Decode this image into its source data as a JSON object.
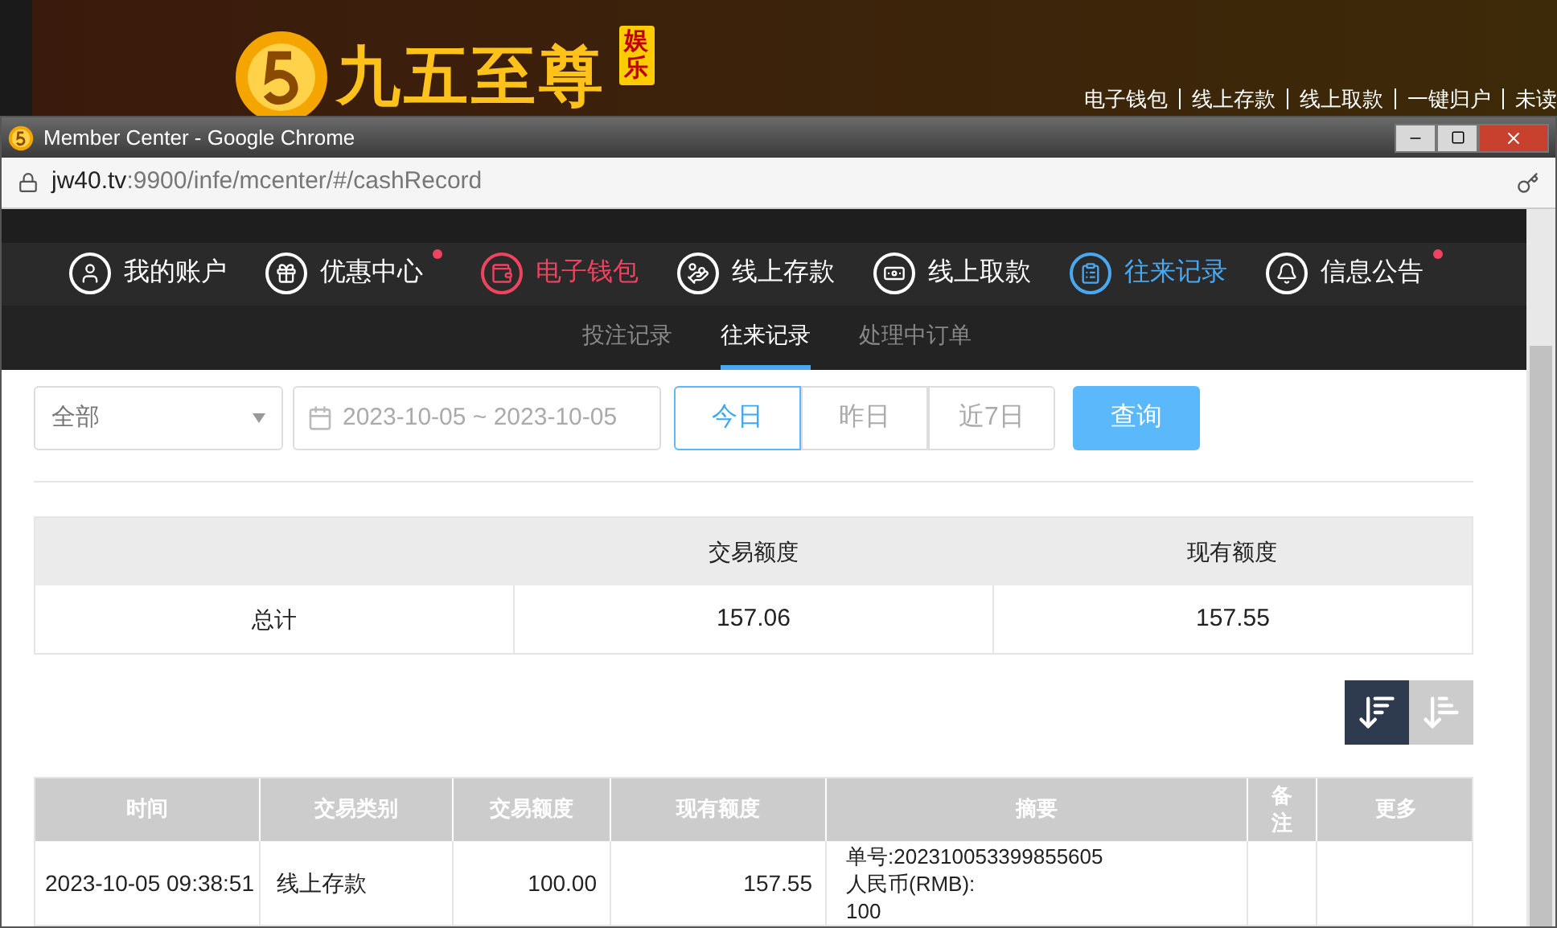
{
  "background_site": {
    "logo_text": "九五至尊",
    "logo_badge": "娱乐",
    "links": [
      "电子钱包",
      "线上存款",
      "线上取款",
      "一键归户",
      "未读"
    ]
  },
  "window": {
    "title": "Member Center - Google Chrome",
    "url_host": "jw40.tv",
    "url_path": ":9900/infe/mcenter/#/cashRecord"
  },
  "nav": [
    {
      "label": "我的账户",
      "dot": false,
      "selected": false,
      "highlighted": false
    },
    {
      "label": "优惠中心",
      "dot": true,
      "selected": false,
      "highlighted": false
    },
    {
      "label": "电子钱包",
      "dot": false,
      "selected": false,
      "highlighted": true
    },
    {
      "label": "线上存款",
      "dot": false,
      "selected": false,
      "highlighted": false
    },
    {
      "label": "线上取款",
      "dot": false,
      "selected": false,
      "highlighted": false
    },
    {
      "label": "往来记录",
      "dot": false,
      "selected": true,
      "highlighted": false
    },
    {
      "label": "信息公告",
      "dot": true,
      "selected": false,
      "highlighted": false
    }
  ],
  "subtabs": [
    {
      "label": "投注记录",
      "selected": false
    },
    {
      "label": "往来记录",
      "selected": true
    },
    {
      "label": "处理中订单",
      "selected": false
    }
  ],
  "filters": {
    "type_select": {
      "value": "全部"
    },
    "date_range": {
      "value": "2023-10-05 ~ 2023-10-05"
    },
    "quick_ranges": [
      {
        "label": "今日",
        "selected": true
      },
      {
        "label": "昨日",
        "selected": false
      },
      {
        "label": "近7日",
        "selected": false
      }
    ],
    "query_button": "查询"
  },
  "summary": {
    "columns": [
      "交易额度",
      "现有额度"
    ],
    "rows": [
      {
        "label": "总计",
        "values": [
          "157.06",
          "157.55"
        ]
      }
    ]
  },
  "sort_buttons": [
    {
      "kind": "desc",
      "selected": true
    },
    {
      "kind": "asc",
      "selected": false
    }
  ],
  "records": {
    "columns": [
      "时间",
      "交易类别",
      "交易额度",
      "现有额度",
      "摘要",
      "备注",
      "更多"
    ],
    "rows": [
      {
        "time": "2023-10-05 09:38:51",
        "type": "线上存款",
        "amount": "100.00",
        "balance": "157.55",
        "summary": [
          "单号:202310053399855605",
          "人民币(RMB):",
          "100"
        ]
      }
    ]
  }
}
